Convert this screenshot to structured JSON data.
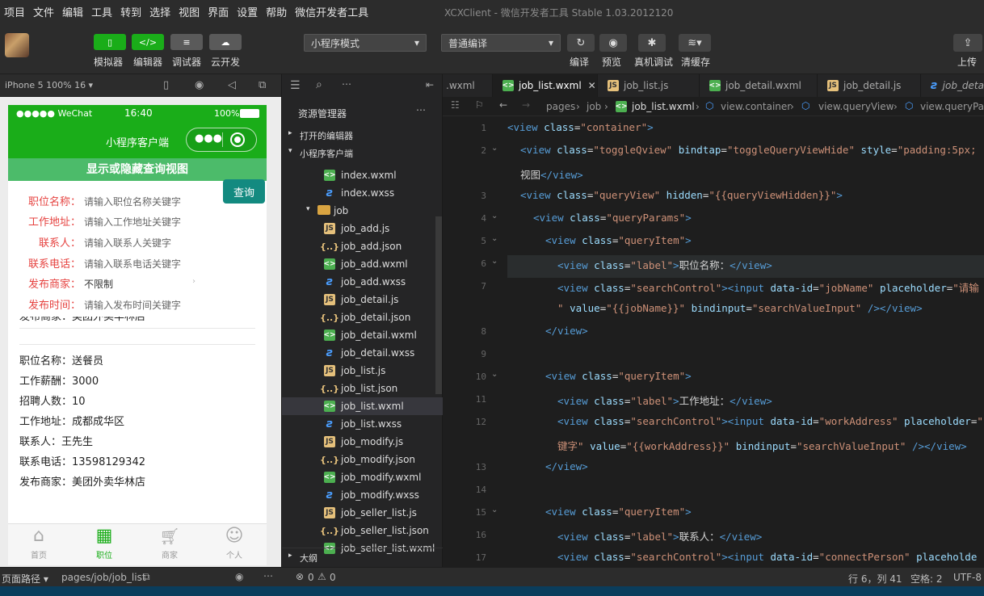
{
  "menu": [
    "项目",
    "文件",
    "编辑",
    "工具",
    "转到",
    "选择",
    "视图",
    "界面",
    "设置",
    "帮助",
    "微信开发者工具"
  ],
  "window_title": "XCXClient - 微信开发者工具 Stable 1.03.2012120",
  "toolbar": {
    "simulator": "模拟器",
    "editor": "编辑器",
    "debugger": "调试器",
    "cloud": "云开发",
    "mode": "小程序模式",
    "compile_mode": "普通编译",
    "compile": "编译",
    "preview": "预览",
    "remote_debug": "真机调试",
    "clear_cache": "清缓存",
    "upload": "上传"
  },
  "sim": {
    "device": "iPhone 5 100% 16 ▾"
  },
  "phone": {
    "carrier": "●●●●● WeChat",
    "time": "16:40",
    "battery": "100%",
    "title": "小程序客户端",
    "toggle": "显示或隐藏查询视图",
    "query_btn": "查询",
    "fields": [
      {
        "label": "职位名称：",
        "placeholder": "请输入职位名称关键字"
      },
      {
        "label": "工作地址：",
        "placeholder": "请输入工作地址关键字"
      },
      {
        "label": "联系人：",
        "placeholder": "请输入联系人关键字"
      },
      {
        "label": "联系电话：",
        "placeholder": "请输入联系电话关键字"
      },
      {
        "label": "发布商家：",
        "placeholder": "不限制"
      },
      {
        "label": "发布时间：",
        "placeholder": "请输入发布时间关键字"
      }
    ],
    "partial": "发布商家：美团外卖华林店",
    "job": [
      "职位名称：送餐员",
      "工作薪酬：3000",
      "招聘人数：10",
      "工作地址：成都成华区",
      "联系人：王先生",
      "联系电话：13598129342",
      "发布商家：美团外卖华林店"
    ],
    "tabs": [
      "首页",
      "职位",
      "商家",
      "个人"
    ]
  },
  "sim_bottom": {
    "path_label": "页面路径 ▾",
    "path": "pages/job/job_list"
  },
  "explorer": {
    "title": "资源管理器",
    "open_editors": "打开的编辑器",
    "project": "小程序客户端",
    "outline": "大纲",
    "files": [
      {
        "name": "index.wxml",
        "type": "wxml"
      },
      {
        "name": "index.wxss",
        "type": "wxss"
      },
      {
        "name": "job",
        "type": "folder"
      },
      {
        "name": "job_add.js",
        "type": "js"
      },
      {
        "name": "job_add.json",
        "type": "json"
      },
      {
        "name": "job_add.wxml",
        "type": "wxml"
      },
      {
        "name": "job_add.wxss",
        "type": "wxss"
      },
      {
        "name": "job_detail.js",
        "type": "js"
      },
      {
        "name": "job_detail.json",
        "type": "json"
      },
      {
        "name": "job_detail.wxml",
        "type": "wxml"
      },
      {
        "name": "job_detail.wxss",
        "type": "wxss"
      },
      {
        "name": "job_list.js",
        "type": "js"
      },
      {
        "name": "job_list.json",
        "type": "json"
      },
      {
        "name": "job_list.wxml",
        "type": "wxml"
      },
      {
        "name": "job_list.wxss",
        "type": "wxss"
      },
      {
        "name": "job_modify.js",
        "type": "js"
      },
      {
        "name": "job_modify.json",
        "type": "json"
      },
      {
        "name": "job_modify.wxml",
        "type": "wxml"
      },
      {
        "name": "job_modify.wxss",
        "type": "wxss"
      },
      {
        "name": "job_seller_list.js",
        "type": "js"
      },
      {
        "name": "job_seller_list.json",
        "type": "json"
      },
      {
        "name": "job_seller_list.wxml",
        "type": "wxml"
      }
    ]
  },
  "editor": {
    "tabs": [
      ".wxml",
      "job_list.wxml",
      "job_list.js",
      "job_detail.wxml",
      "job_detail.js",
      "job_deta"
    ],
    "breadcrumb": [
      "pages",
      "job",
      "job_list.wxml",
      "view.container",
      "view.queryView",
      "view.queryPar"
    ],
    "line_numbers": [
      "1",
      "2",
      "",
      "3",
      "4",
      "5",
      "6",
      "7",
      "",
      "8",
      "9",
      "10",
      "11",
      "12",
      "",
      "13",
      "14",
      "15",
      "16",
      "17"
    ]
  },
  "status": {
    "errors": "0",
    "warnings": "0",
    "position": "行 6，列 41",
    "spaces": "空格: 2",
    "encoding": "UTF-8"
  }
}
